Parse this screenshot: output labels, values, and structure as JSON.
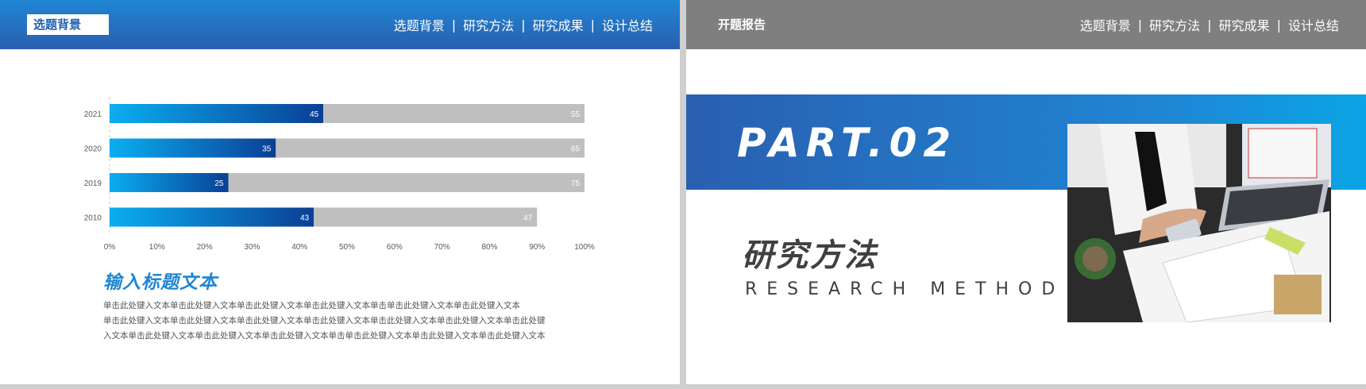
{
  "left_slide": {
    "tag": "选题背景",
    "nav": [
      "选题背景",
      "研究方法",
      "研究成果",
      "设计总结"
    ],
    "nav_separator": "|",
    "subtitle": "输入标题文本",
    "body_lines": [
      "单击此处键入文本单击此处键入文本单击此处键入文本单击此处键入文本单击单击此处键入文本单击此处键入文本",
      "单击此处键入文本单击此处键入文本单击此处键入文本单击此处键入文本单击此处键入文本单击此处键入文本单击此处键",
      "入文本单击此处键入文本单击此处键入文本单击此处键入文本单击单击此处键入文本单击此处键入文本单击此处键入文本"
    ]
  },
  "right_slide": {
    "header_title": "开题报告",
    "nav": [
      "选题背景",
      "研究方法",
      "研究成果",
      "设计总结"
    ],
    "nav_separator": "|",
    "part_label": "PART.02",
    "method_cn": "研究方法",
    "method_en": "RESEARCH METHOD",
    "photo_icon": "business-desk-photo"
  },
  "colors": {
    "blue_dark": "#2a5fb0",
    "blue_light": "#1f86d4",
    "bar_start": "#0aaef0",
    "bar_end": "#0b3f95",
    "bar_rest": "#bfbfbf",
    "header_gray": "#7f7f7f"
  },
  "chart_data": {
    "type": "bar",
    "orientation": "horizontal",
    "stacked": true,
    "categories": [
      "2021",
      "2020",
      "2019",
      "2010"
    ],
    "series": [
      {
        "values": [
          45,
          35,
          25,
          43
        ]
      },
      {
        "values": [
          55,
          65,
          75,
          47
        ]
      }
    ],
    "xlim": [
      0,
      100
    ],
    "x_ticks": [
      "0%",
      "10%",
      "20%",
      "30%",
      "40%",
      "50%",
      "60%",
      "70%",
      "80%",
      "90%",
      "100%"
    ],
    "grid": false,
    "legend": "none"
  }
}
